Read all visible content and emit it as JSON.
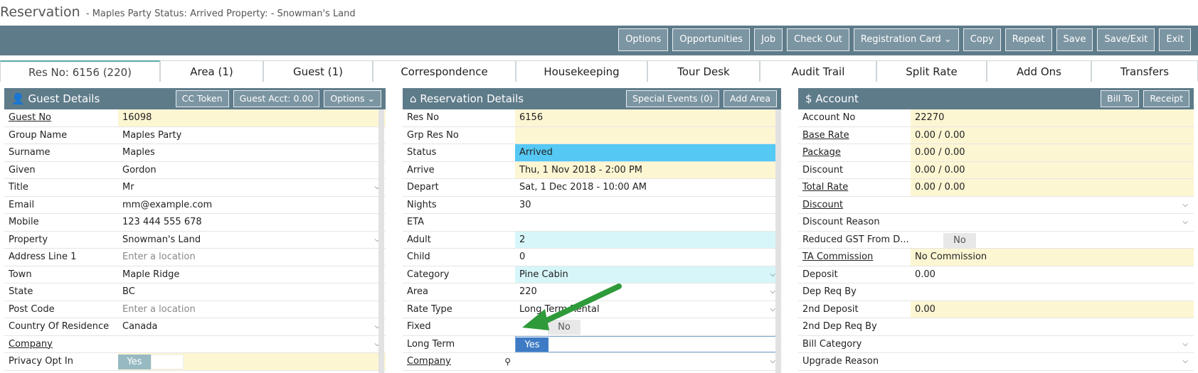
{
  "header": {
    "title": "Reservation",
    "subtitle": "- Maples Party Status: Arrived Property: - Snowman's Land"
  },
  "toolbar": [
    "Options",
    "Opportunities",
    "Job",
    "Check Out",
    "Registration Card ⌄",
    "Copy",
    "Repeat",
    "Save",
    "Save/Exit",
    "Exit"
  ],
  "tabs": [
    "Res No: 6156 (220)",
    "Area (1)",
    "Guest (1)",
    "Correspondence",
    "Housekeeping",
    "Tour Desk",
    "Audit Trail",
    "Split Rate",
    "Add Ons",
    "Transfers"
  ],
  "guest": {
    "title": "Guest Details",
    "buttons": [
      "CC Token",
      "Guest Acct: 0.00",
      "Options ⌄"
    ],
    "rows": [
      {
        "label": "Guest No",
        "value": "16098"
      },
      {
        "label": "Group Name",
        "value": "Maples Party"
      },
      {
        "label": "Surname",
        "value": "Maples"
      },
      {
        "label": "Given",
        "value": "Gordon"
      },
      {
        "label": "Title",
        "value": "Mr"
      },
      {
        "label": "Email",
        "value": "mm@example.com"
      },
      {
        "label": "Mobile",
        "value": "123 444 555 678"
      },
      {
        "label": "Property",
        "value": "Snowman's Land"
      },
      {
        "label": "Address Line 1",
        "value": "Enter a location"
      },
      {
        "label": "Town",
        "value": "Maple Ridge"
      },
      {
        "label": "State",
        "value": "BC"
      },
      {
        "label": "Post Code",
        "value": "Enter a location"
      },
      {
        "label": "Country Of Residence",
        "value": "Canada"
      },
      {
        "label": "Company",
        "value": ""
      },
      {
        "label": "Privacy Opt In",
        "value": "Yes"
      }
    ]
  },
  "reservation": {
    "title": "Reservation Details",
    "buttons": [
      "Special Events (0)",
      "Add Area"
    ],
    "rows": [
      {
        "label": "Res No",
        "value": "6156"
      },
      {
        "label": "Grp Res No",
        "value": ""
      },
      {
        "label": "Status",
        "value": "Arrived"
      },
      {
        "label": "Arrive",
        "value": "Thu, 1 Nov 2018 - 2:00 PM"
      },
      {
        "label": "Depart",
        "value": "Sat, 1 Dec 2018 - 10:00 AM"
      },
      {
        "label": "Nights",
        "value": "30"
      },
      {
        "label": "ETA",
        "value": ""
      },
      {
        "label": "Adult",
        "value": "2"
      },
      {
        "label": "Child",
        "value": "0"
      },
      {
        "label": "Category",
        "value": "Pine Cabin"
      },
      {
        "label": "Area",
        "value": "220"
      },
      {
        "label": "Rate Type",
        "value": "Long Term Rental"
      },
      {
        "label": "Fixed",
        "value": "No"
      },
      {
        "label": "Long Term",
        "value": "Yes"
      },
      {
        "label": "Company",
        "value": ""
      }
    ]
  },
  "account": {
    "title": "Account",
    "buttons": [
      "Bill To",
      "Receipt"
    ],
    "rows": [
      {
        "label": "Account No",
        "value": "22270"
      },
      {
        "label": "Base Rate",
        "value": "0.00 / 0.00"
      },
      {
        "label": "Package",
        "value": "0.00 / 0.00"
      },
      {
        "label": "Discount",
        "value": "0.00 / 0.00"
      },
      {
        "label": "Total Rate",
        "value": "0.00 / 0.00"
      },
      {
        "label": "Discount",
        "value": ""
      },
      {
        "label": "Discount Reason",
        "value": ""
      },
      {
        "label": "Reduced GST From D...",
        "value": "No"
      },
      {
        "label": "TA Commission",
        "value": "No Commission"
      },
      {
        "label": "Deposit",
        "value": "0.00"
      },
      {
        "label": "Dep Req By",
        "value": ""
      },
      {
        "label": "2nd Deposit",
        "value": "0.00"
      },
      {
        "label": "2nd Dep Req By",
        "value": ""
      },
      {
        "label": "Bill Category",
        "value": ""
      },
      {
        "label": "Upgrade Reason",
        "value": ""
      }
    ]
  },
  "colors": {
    "header": "#5e7b8a",
    "accent": "#3e7bc4",
    "arrow": "#2e9a3a"
  }
}
